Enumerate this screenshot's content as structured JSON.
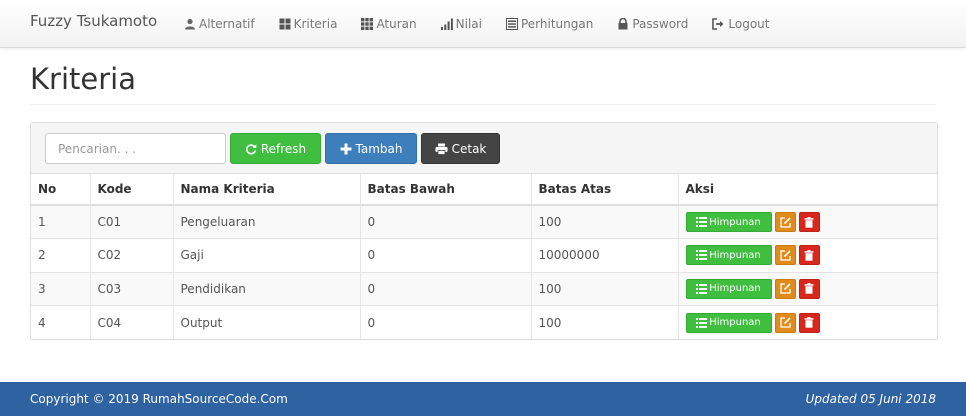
{
  "navbar": {
    "brand": "Fuzzy Tsukamoto",
    "items": [
      {
        "label": "Alternatif",
        "icon": "user-icon"
      },
      {
        "label": "Kriteria",
        "icon": "th-large-icon"
      },
      {
        "label": "Aturan",
        "icon": "th-icon"
      },
      {
        "label": "Nilai",
        "icon": "signal-icon"
      },
      {
        "label": "Perhitungan",
        "icon": "list-alt-icon"
      },
      {
        "label": "Password",
        "icon": "lock-icon"
      },
      {
        "label": "Logout",
        "icon": "log-out-icon"
      }
    ]
  },
  "page": {
    "title": "Kriteria"
  },
  "toolbar": {
    "search_placeholder": "Pencarian. . .",
    "refresh_label": "Refresh",
    "tambah_label": "Tambah",
    "cetak_label": "Cetak"
  },
  "table": {
    "headers": [
      "No",
      "Kode",
      "Nama Kriteria",
      "Batas Bawah",
      "Batas Atas",
      "Aksi"
    ],
    "rows": [
      {
        "no": "1",
        "kode": "C01",
        "nama": "Pengeluaran",
        "bawah": "0",
        "atas": "100"
      },
      {
        "no": "2",
        "kode": "C02",
        "nama": "Gaji",
        "bawah": "0",
        "atas": "10000000"
      },
      {
        "no": "3",
        "kode": "C03",
        "nama": "Pendidikan",
        "bawah": "0",
        "atas": "100"
      },
      {
        "no": "4",
        "kode": "C04",
        "nama": "Output",
        "bawah": "0",
        "atas": "100"
      }
    ],
    "himpunan_label": "Himpunan"
  },
  "footer": {
    "copyright": "Copyright © 2019 RumahSourceCode.Com",
    "updated": "Updated 05 Juni 2018"
  },
  "colors": {
    "footer_bg": "#2f62a0",
    "success": "#3fbe3f",
    "primary": "#3d7ebc",
    "dark": "#444444",
    "warning": "#e08c1c",
    "danger": "#d9271e"
  }
}
